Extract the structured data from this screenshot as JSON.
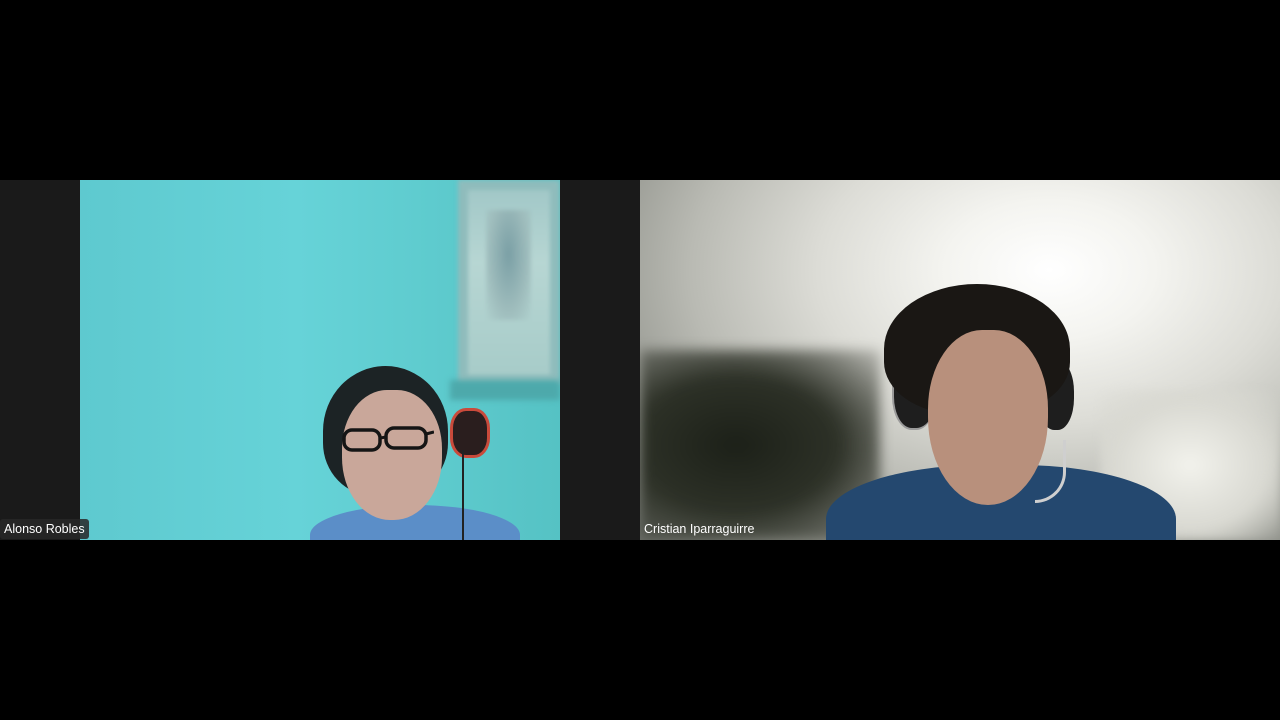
{
  "meeting": {
    "participants": [
      {
        "name": "Alonso Robles",
        "shirt_color": "#5b8ec8",
        "background_color": "#66d3d8"
      },
      {
        "name": "Cristian Iparraguirre",
        "shirt_color": "#24486f",
        "background_color": "#dcdcd6"
      }
    ]
  },
  "colors": {
    "page_background": "#000000",
    "tile_background": "#1a1a1a",
    "label_text": "#ffffff",
    "label_background": "#282828"
  }
}
